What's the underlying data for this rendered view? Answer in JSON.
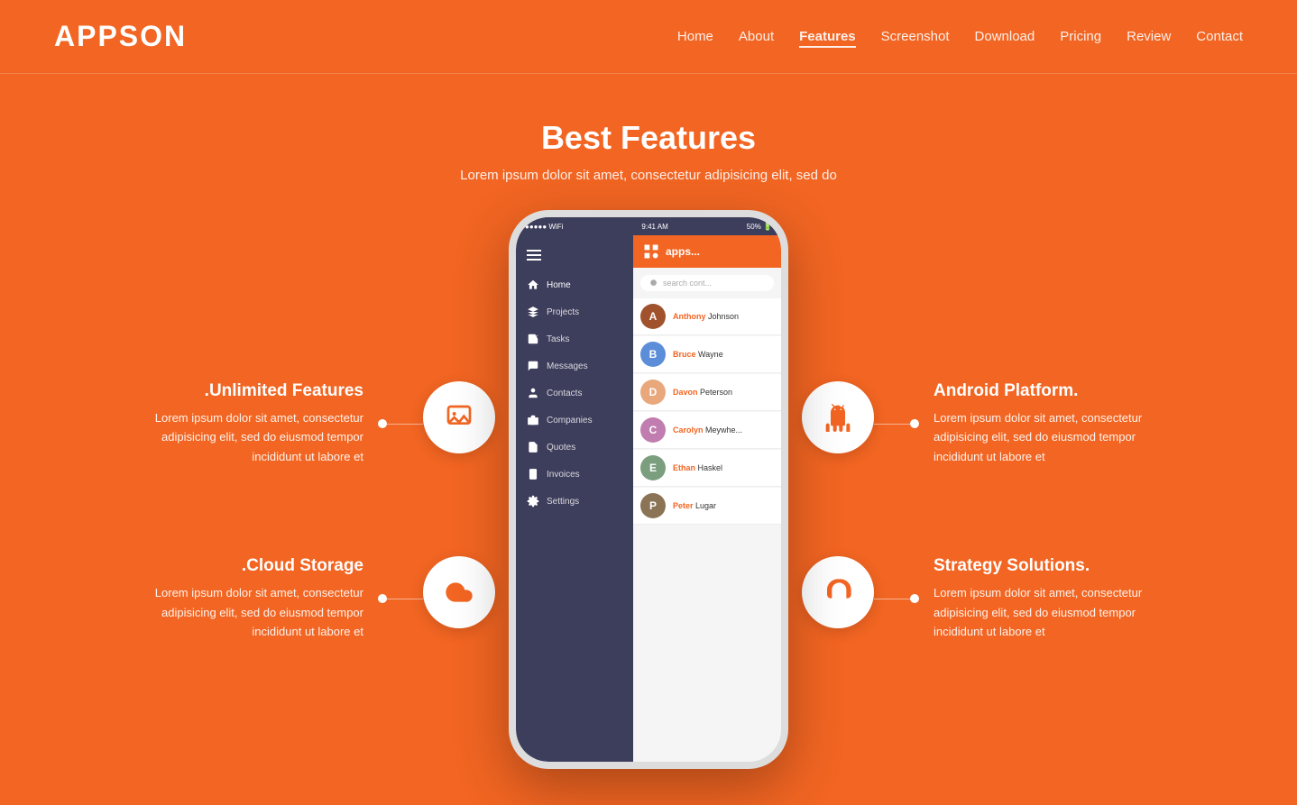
{
  "brand": {
    "name": "APPSON"
  },
  "nav": {
    "items": [
      {
        "label": "Home",
        "active": false
      },
      {
        "label": "About",
        "active": false
      },
      {
        "label": "Features",
        "active": true
      },
      {
        "label": "Screenshot",
        "active": false
      },
      {
        "label": "Download",
        "active": false
      },
      {
        "label": "Pricing",
        "active": false
      },
      {
        "label": "Review",
        "active": false
      },
      {
        "label": "Contact",
        "active": false
      }
    ]
  },
  "section": {
    "title": "Best Features",
    "subtitle": "Lorem ipsum dolor sit amet, consectetur adipisicing elit, sed do"
  },
  "features": {
    "left": [
      {
        "title": ".Unlimited Features",
        "desc": "Lorem ipsum dolor sit amet, consectetur adipisicing elit, sed do eiusmod tempor incididunt ut labore et"
      },
      {
        "title": ".Cloud Storage",
        "desc": "Lorem ipsum dolor sit amet, consectetur adipisicing elit, sed do eiusmod tempor incididunt ut labore et"
      }
    ],
    "right": [
      {
        "title": "Android Platform.",
        "desc": "Lorem ipsum dolor sit amet, consectetur adipisicing elit, sed do eiusmod tempor incididunt ut labore et"
      },
      {
        "title": "Strategy Solutions.",
        "desc": "Lorem ipsum dolor sit amet, consectetur adipisicing elit, sed do eiusmod tempor incididunt ut labore et"
      }
    ]
  },
  "phone": {
    "status_time": "9:41 AM",
    "status_battery": "50%",
    "sidebar_items": [
      {
        "icon": "home",
        "label": "Home"
      },
      {
        "icon": "rocket",
        "label": "Projects"
      },
      {
        "icon": "check",
        "label": "Tasks"
      },
      {
        "icon": "message",
        "label": "Messages"
      },
      {
        "icon": "contact",
        "label": "Contacts"
      },
      {
        "icon": "building",
        "label": "Companies"
      },
      {
        "icon": "quote",
        "label": "Quotes"
      },
      {
        "icon": "invoice",
        "label": "Invoices"
      },
      {
        "icon": "settings",
        "label": "Settings"
      }
    ],
    "search_placeholder": "search cont...",
    "contacts": [
      {
        "first": "Anthony",
        "last": "Johnson"
      },
      {
        "first": "Bruce",
        "last": "Wayne"
      },
      {
        "first": "Davon",
        "last": "Peterson"
      },
      {
        "first": "Carolyn",
        "last": "Meywhe..."
      },
      {
        "first": "Ethan",
        "last": "Haskel"
      },
      {
        "first": "Peter",
        "last": "Lugar"
      }
    ]
  },
  "colors": {
    "primary": "#f26522",
    "dark_sidebar": "#3d3d5c",
    "white": "#ffffff"
  }
}
